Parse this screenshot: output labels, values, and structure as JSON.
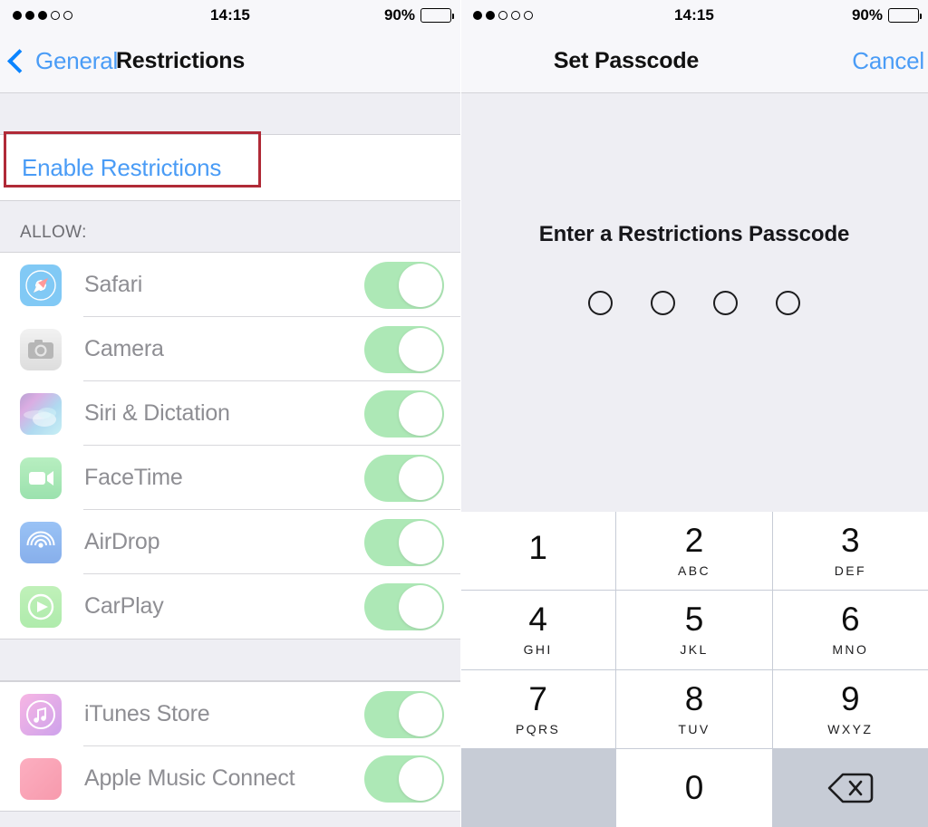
{
  "left": {
    "status": {
      "signal_filled": 3,
      "signal_total": 5,
      "time": "14:15",
      "battery_pct": "90%",
      "battery_level": 90
    },
    "nav": {
      "back_label": "General",
      "title": "Restrictions"
    },
    "enable_row": {
      "label": "Enable Restrictions",
      "highlight_color": "#b02a37"
    },
    "section_header": "ALLOW:",
    "allow_items": [
      {
        "label": "Safari",
        "icon": "safari-icon",
        "toggle": "on"
      },
      {
        "label": "Camera",
        "icon": "camera-icon",
        "toggle": "on"
      },
      {
        "label": "Siri & Dictation",
        "icon": "siri-icon",
        "toggle": "on"
      },
      {
        "label": "FaceTime",
        "icon": "facetime-icon",
        "toggle": "on"
      },
      {
        "label": "AirDrop",
        "icon": "airdrop-icon",
        "toggle": "on"
      },
      {
        "label": "CarPlay",
        "icon": "carplay-icon",
        "toggle": "on"
      }
    ],
    "store_items": [
      {
        "label": "iTunes Store",
        "icon": "itunes-store-icon",
        "toggle": "on"
      },
      {
        "label": "Apple Music Connect",
        "icon": "apple-music-connect-icon",
        "toggle": "on"
      }
    ]
  },
  "right": {
    "status": {
      "signal_filled": 2,
      "signal_total": 5,
      "time": "14:15",
      "battery_pct": "90%",
      "battery_level": 90
    },
    "nav": {
      "title": "Set Passcode",
      "cancel_label": "Cancel"
    },
    "passcode": {
      "prompt": "Enter a Restrictions Passcode",
      "length": 4,
      "entered": 0
    },
    "keypad": [
      {
        "num": "1",
        "letters": ""
      },
      {
        "num": "2",
        "letters": "ABC"
      },
      {
        "num": "3",
        "letters": "DEF"
      },
      {
        "num": "4",
        "letters": "GHI"
      },
      {
        "num": "5",
        "letters": "JKL"
      },
      {
        "num": "6",
        "letters": "MNO"
      },
      {
        "num": "7",
        "letters": "PQRS"
      },
      {
        "num": "8",
        "letters": "TUV"
      },
      {
        "num": "9",
        "letters": "WXYZ"
      },
      {
        "num": "",
        "letters": ""
      },
      {
        "num": "0",
        "letters": ""
      },
      {
        "num": "",
        "letters": "",
        "icon": "backspace-icon"
      }
    ]
  },
  "colors": {
    "ios_blue": "#4a9cf6",
    "toggle_green": "#8ee09a",
    "highlight_red": "#b02a37",
    "panel_bg": "#eeeef3",
    "keypad_gray": "#c7ccd6"
  }
}
